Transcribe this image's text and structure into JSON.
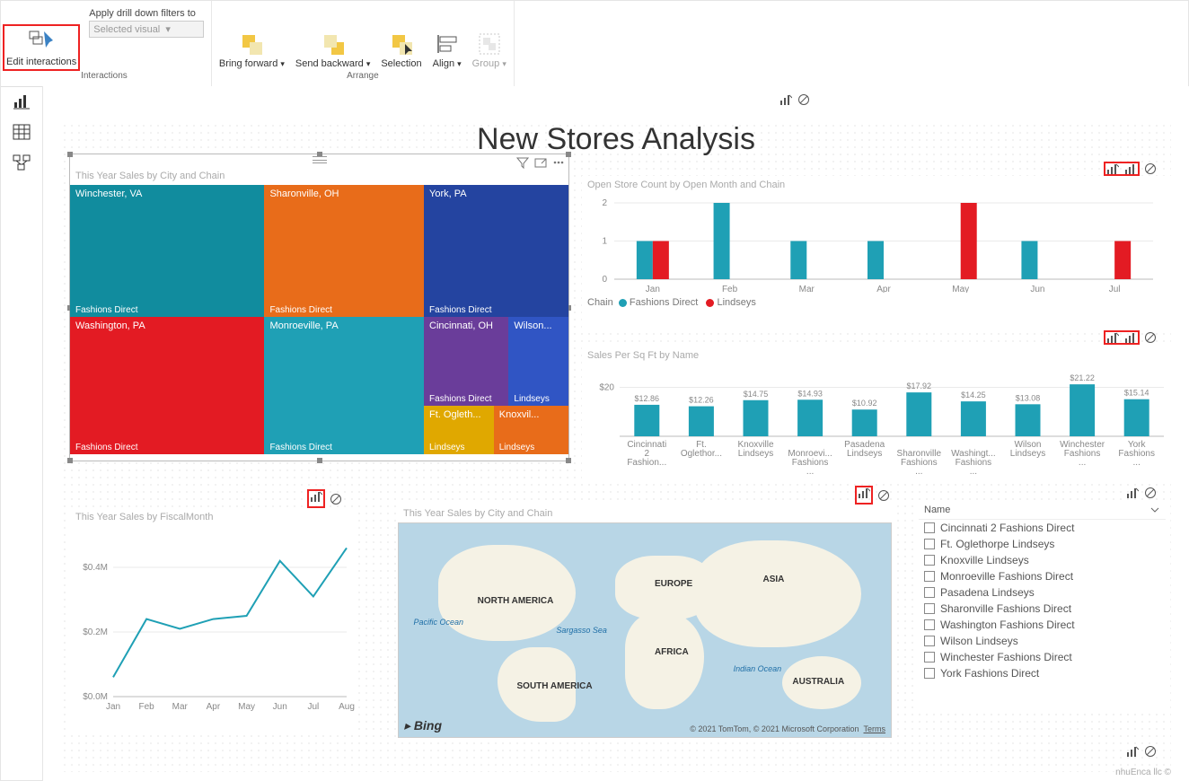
{
  "ribbon": {
    "edit_interactions": "Edit interactions",
    "apply_label": "Apply drill down filters to",
    "selected_visual": "Selected visual",
    "bring_forward": "Bring forward",
    "send_backward": "Send backward",
    "selection": "Selection",
    "align": "Align",
    "group": "Group",
    "group_interactions": "Interactions",
    "group_arrange": "Arrange"
  },
  "page_title": "New Stores Analysis",
  "treemap": {
    "title": "This Year Sales by City and Chain",
    "cells": {
      "winchester": {
        "label": "Winchester, VA",
        "chain": "Fashions Direct"
      },
      "washington": {
        "label": "Washington, PA",
        "chain": "Fashions Direct"
      },
      "sharonville": {
        "label": "Sharonville, OH",
        "chain": "Fashions Direct"
      },
      "monroeville": {
        "label": "Monroeville, PA",
        "chain": "Fashions Direct"
      },
      "york": {
        "label": "York, PA",
        "chain": "Fashions Direct"
      },
      "cincinnati": {
        "label": "Cincinnati, OH",
        "chain": "Fashions Direct"
      },
      "wilson": {
        "label": "Wilson...",
        "chain": "Lindseys"
      },
      "ft": {
        "label": "Ft. Ogleth...",
        "chain": "Lindseys"
      },
      "knox": {
        "label": "Knoxvil...",
        "chain": "Lindseys"
      }
    }
  },
  "storecount": {
    "title": "Open Store Count by Open Month and Chain",
    "legend_label": "Chain",
    "series_fd": "Fashions Direct",
    "series_li": "Lindseys"
  },
  "sqft": {
    "title": "Sales Per Sq Ft by Name"
  },
  "line": {
    "title": "This Year Sales by FiscalMonth",
    "y0": "$0.0M",
    "y2": "$0.2M",
    "y4": "$0.4M"
  },
  "mapvis": {
    "title": "This Year Sales by City and Chain",
    "na": "NORTH AMERICA",
    "eu": "EUROPE",
    "as": "ASIA",
    "af": "AFRICA",
    "sa": "SOUTH AMERICA",
    "au": "AUSTRALIA",
    "pacific": "Pacific Ocean",
    "sargasso": "Sargasso Sea",
    "indian": "Indian Ocean",
    "bing": "Bing",
    "attr": "© 2021 TomTom, © 2021 Microsoft Corporation",
    "terms": "Terms"
  },
  "slicer": {
    "header": "Name",
    "items": [
      "Cincinnati 2 Fashions Direct",
      "Ft. Oglethorpe Lindseys",
      "Knoxville Lindseys",
      "Monroeville Fashions Direct",
      "Pasadena Lindseys",
      "Sharonville Fashions Direct",
      "Washington Fashions Direct",
      "Wilson Lindseys",
      "Winchester Fashions Direct",
      "York Fashions Direct"
    ]
  },
  "footer": "nhuEnca llc ©",
  "chart_data": [
    {
      "type": "treemap",
      "title": "This Year Sales by City and Chain",
      "items": [
        {
          "city": "Winchester, VA",
          "chain": "Fashions Direct",
          "weight": 20
        },
        {
          "city": "Washington, PA",
          "chain": "Fashions Direct",
          "weight": 20
        },
        {
          "city": "Sharonville, OH",
          "chain": "Fashions Direct",
          "weight": 15
        },
        {
          "city": "Monroeville, PA",
          "chain": "Fashions Direct",
          "weight": 15
        },
        {
          "city": "York, PA",
          "chain": "Fashions Direct",
          "weight": 14
        },
        {
          "city": "Cincinnati, OH",
          "chain": "Fashions Direct",
          "weight": 6
        },
        {
          "city": "Wilson",
          "chain": "Lindseys",
          "weight": 6
        },
        {
          "city": "Ft. Oglethorpe",
          "chain": "Lindseys",
          "weight": 3
        },
        {
          "city": "Knoxville",
          "chain": "Lindseys",
          "weight": 3
        }
      ]
    },
    {
      "type": "bar",
      "title": "Open Store Count by Open Month and Chain",
      "categories": [
        "Jan",
        "Feb",
        "Mar",
        "Apr",
        "May",
        "Jun",
        "Jul"
      ],
      "series": [
        {
          "name": "Fashions Direct",
          "values": [
            1,
            2,
            1,
            1,
            0,
            1,
            0
          ]
        },
        {
          "name": "Lindseys",
          "values": [
            1,
            0,
            0,
            0,
            2,
            0,
            1
          ]
        }
      ],
      "ylim": [
        0,
        2
      ]
    },
    {
      "type": "bar",
      "title": "Sales Per Sq Ft by Name",
      "categories": [
        "Cincinnati 2 Fashion...",
        "Ft. Oglethor...",
        "Knoxville Lindseys",
        "Monroevi... Fashions ...",
        "Pasadena Lindseys",
        "Sharonville Fashions ...",
        "Washingt... Fashions ...",
        "Wilson Lindseys",
        "Winchester Fashions ...",
        "York Fashions ..."
      ],
      "values": [
        12.86,
        12.26,
        14.75,
        14.93,
        10.92,
        17.92,
        14.25,
        13.08,
        21.22,
        15.14
      ],
      "value_labels": [
        "$12.86",
        "$12.26",
        "$14.75",
        "$14.93",
        "$10.92",
        "$17.92",
        "$14.25",
        "$13.08",
        "$21.22",
        "$15.14"
      ],
      "ylabel": "",
      "ylim": [
        0,
        22
      ],
      "yticks": [
        20
      ],
      "ytick_labels": [
        "$20"
      ]
    },
    {
      "type": "line",
      "title": "This Year Sales by FiscalMonth",
      "categories": [
        "Jan",
        "Feb",
        "Mar",
        "Apr",
        "May",
        "Jun",
        "Jul",
        "Aug"
      ],
      "values": [
        0.06,
        0.24,
        0.21,
        0.24,
        0.25,
        0.42,
        0.31,
        0.46
      ],
      "ylim": [
        0,
        0.5
      ],
      "yticks": [
        0,
        0.2,
        0.4
      ],
      "ytick_labels": [
        "$0.0M",
        "$0.2M",
        "$0.4M"
      ]
    }
  ]
}
